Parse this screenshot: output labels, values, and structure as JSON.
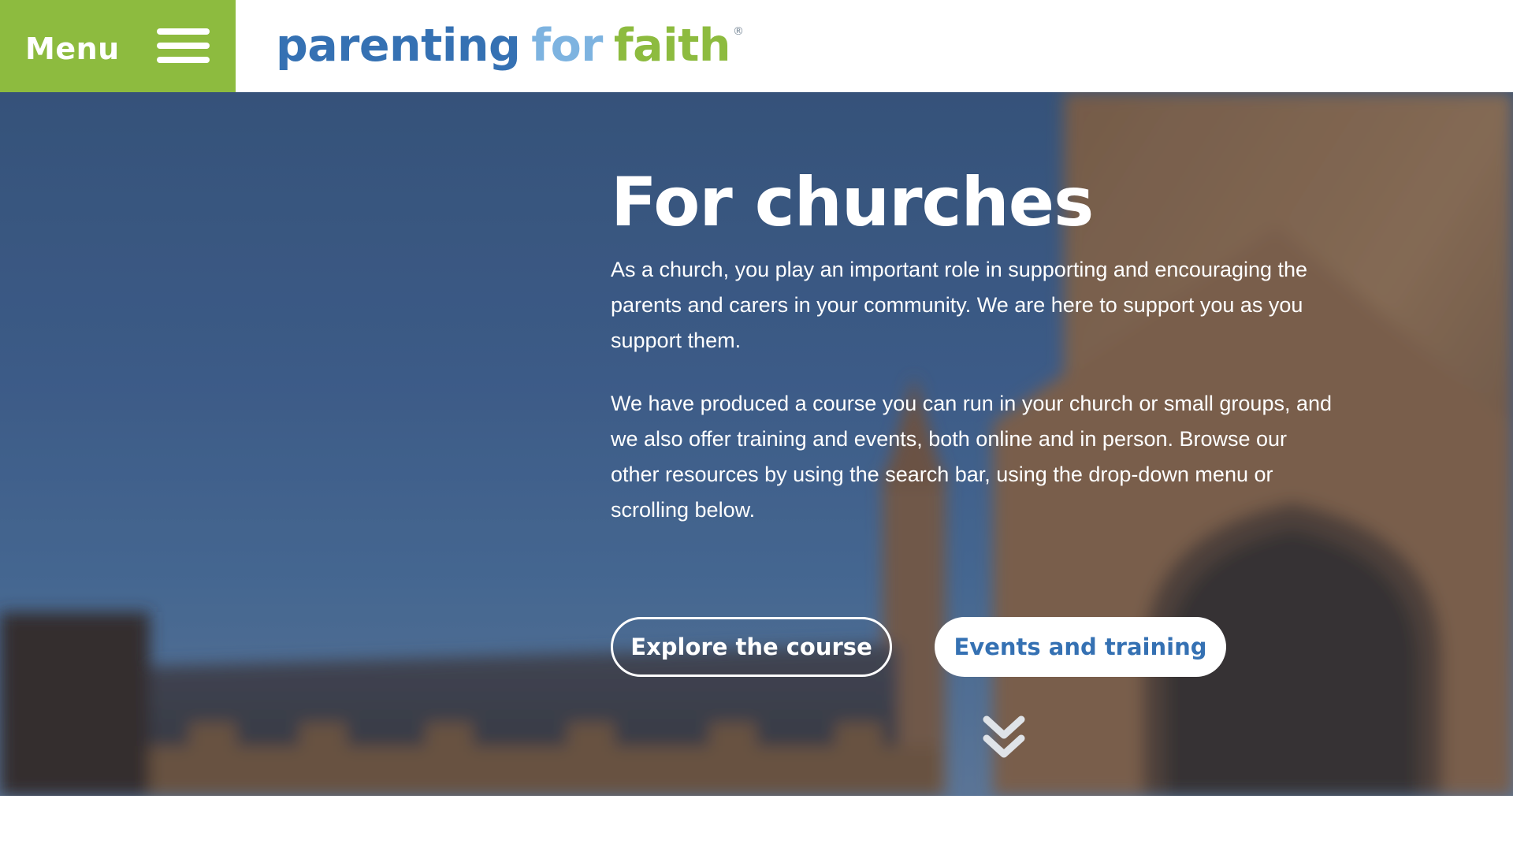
{
  "header": {
    "menu_label": "Menu",
    "logo": {
      "part1": "parenting",
      "part2": "for",
      "part3": "faith",
      "reg": "®"
    }
  },
  "hero": {
    "title": "For churches",
    "paragraph1": "As a church, you play an important role in supporting and encouraging the parents and carers in your community. We are here to support you as you support them.",
    "paragraph2": "We have produced a course you can run in your church or small groups, and we also offer training and events, both online and in person. Browse our other resources by using the search bar, using the drop-down menu or scrolling below.",
    "buttons": {
      "explore": "Explore the course",
      "events": "Events and training"
    },
    "scroll_icon": "double-chevron-down-icon"
  },
  "colors": {
    "menu_green": "#8dbb3f",
    "logo_blue": "#3571b3",
    "logo_light_blue": "#7db3e0",
    "logo_green": "#8dbb3f",
    "sky": "#45699a"
  }
}
